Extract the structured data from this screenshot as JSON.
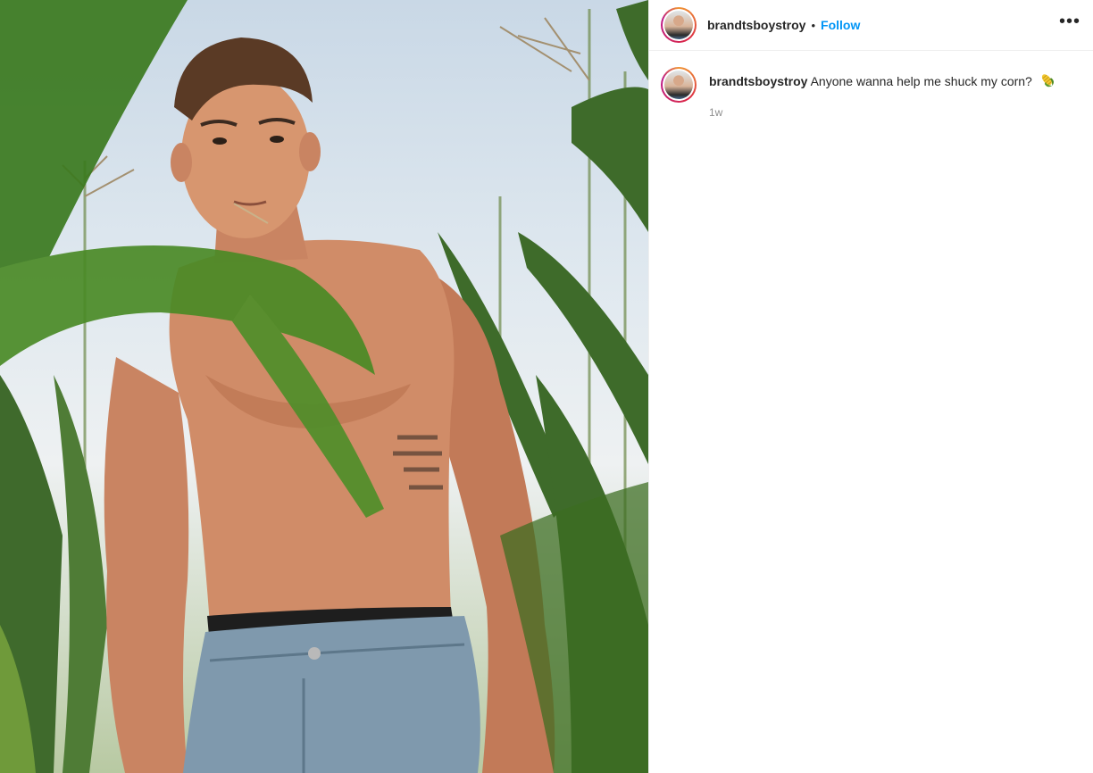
{
  "post": {
    "author": "brandtsboystroy",
    "separator": "•",
    "follow_label": "Follow",
    "more_icon": "more-horizontal-icon",
    "more_label": "•••"
  },
  "caption": {
    "username": "brandtsboystroy",
    "text": "Anyone wanna help me shuck my corn?",
    "emoji_icon": "corn-icon",
    "time": "1w"
  },
  "colors": {
    "follow": "#0095f6",
    "text": "#262626",
    "secondary": "#8e8e8e",
    "divider": "#efefef"
  }
}
